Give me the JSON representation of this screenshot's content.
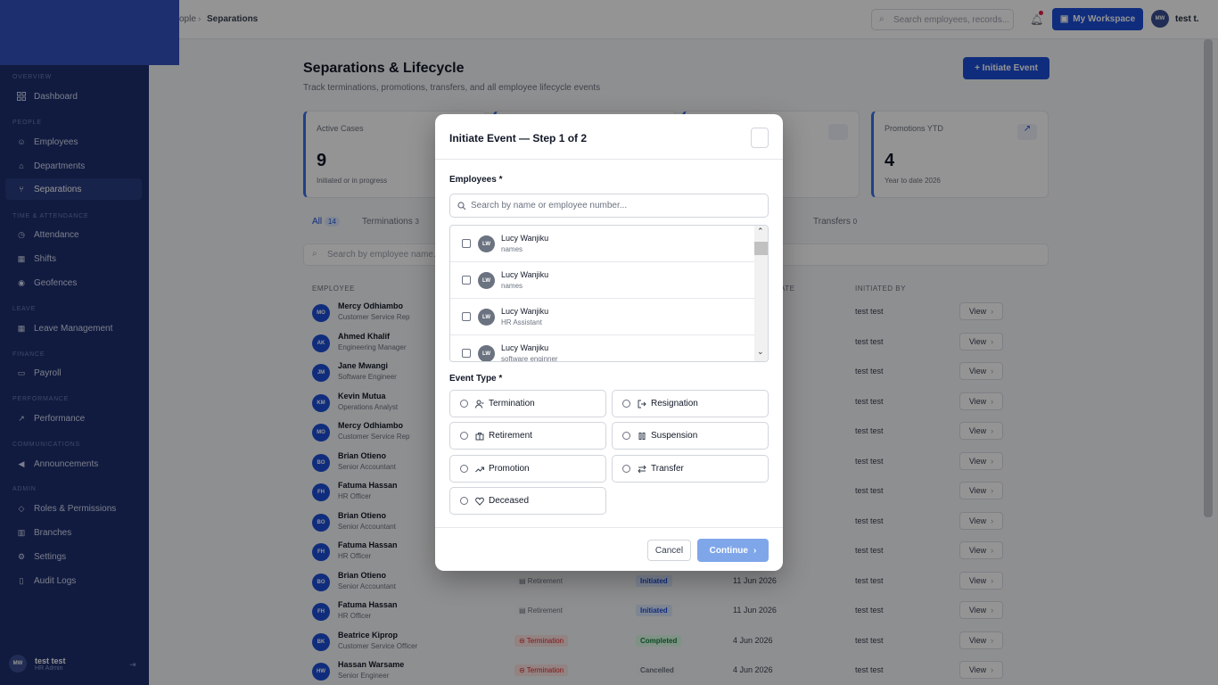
{
  "sidebar": {
    "sections": [
      {
        "label": "OVERVIEW",
        "items": [
          {
            "label": "Dashboard",
            "icon": "grid-icon"
          }
        ]
      },
      {
        "label": "PEOPLE",
        "items": [
          {
            "label": "Employees",
            "icon": "users-icon"
          },
          {
            "label": "Departments",
            "icon": "org-icon"
          },
          {
            "label": "Separations",
            "icon": "branch-icon"
          }
        ]
      },
      {
        "label": "TIME & ATTENDANCE",
        "items": [
          {
            "label": "Attendance",
            "icon": "clock-icon"
          },
          {
            "label": "Shifts",
            "icon": "calendar-icon"
          },
          {
            "label": "Geofences",
            "icon": "pin-icon"
          }
        ]
      },
      {
        "label": "LEAVE",
        "items": [
          {
            "label": "Leave Management",
            "icon": "calendar-icon"
          }
        ]
      },
      {
        "label": "FINANCE",
        "items": [
          {
            "label": "Payroll",
            "icon": "wallet-icon"
          }
        ]
      },
      {
        "label": "PERFORMANCE",
        "items": [
          {
            "label": "Performance",
            "icon": "trend-icon"
          }
        ]
      },
      {
        "label": "COMMUNICATIONS",
        "items": [
          {
            "label": "Announcements",
            "icon": "megaphone-icon"
          }
        ]
      },
      {
        "label": "ADMIN",
        "items": [
          {
            "label": "Roles & Permissions",
            "icon": "shield-icon"
          },
          {
            "label": "Branches",
            "icon": "building-icon"
          },
          {
            "label": "Settings",
            "icon": "gear-icon"
          },
          {
            "label": "Audit Logs",
            "icon": "file-icon"
          }
        ]
      }
    ],
    "user": {
      "initials": "MW",
      "name": "test test",
      "role": "HR Admin"
    }
  },
  "topbar": {
    "crumb_parent": "ople",
    "crumb_current": "Separations",
    "search_placeholder": "Search employees, records...",
    "workspace_label": "My Workspace",
    "user_initials": "MW",
    "user_name": "test t."
  },
  "page": {
    "title": "Separations & Lifecycle",
    "subtitle": "Track terminations, promotions, transfers, and all employee lifecycle events",
    "initiate_label": "+ Initiate Event",
    "cards": [
      {
        "label": "Active Cases",
        "value": "9",
        "sub": "Initiated or in progress"
      },
      {
        "label": "Promotions YTD",
        "value": "4",
        "sub": "Year to date 2026"
      }
    ],
    "tabs": [
      {
        "label": "All",
        "count": "14"
      },
      {
        "label": "Terminations",
        "count": "3"
      },
      {
        "label": "Transfers",
        "count": "0"
      }
    ],
    "table_search_placeholder": "Search by employee name...",
    "columns": {
      "employee": "EMPLOYEE",
      "date": "ATE",
      "initiated_by": "INITIATED BY"
    },
    "rows": [
      {
        "initials": "MO",
        "name": "Mercy Odhiambo",
        "role": "Customer Service Rep",
        "type": "",
        "status": "",
        "status_class": "",
        "date": "",
        "by": "test test",
        "view": "View"
      },
      {
        "initials": "AK",
        "name": "Ahmed Khalif",
        "role": "Engineering Manager",
        "type": "",
        "status": "",
        "status_class": "",
        "date": "",
        "by": "test test",
        "view": "View"
      },
      {
        "initials": "JM",
        "name": "Jane Mwangi",
        "role": "Software Engineer",
        "type": "",
        "status": "",
        "status_class": "",
        "date": "",
        "by": "test test",
        "view": "View"
      },
      {
        "initials": "KM",
        "name": "Kevin Mutua",
        "role": "Operations Analyst",
        "type": "",
        "status": "",
        "status_class": "",
        "date": "",
        "by": "test test",
        "view": "View"
      },
      {
        "initials": "MO",
        "name": "Mercy Odhiambo",
        "role": "Customer Service Rep",
        "type": "",
        "status": "",
        "status_class": "",
        "date": "",
        "by": "test test",
        "view": "View"
      },
      {
        "initials": "BO",
        "name": "Brian Otieno",
        "role": "Senior Accountant",
        "type": "",
        "status": "",
        "status_class": "",
        "date": "",
        "by": "test test",
        "view": "View"
      },
      {
        "initials": "FH",
        "name": "Fatuma Hassan",
        "role": "HR Officer",
        "type": "",
        "status": "",
        "status_class": "",
        "date": "",
        "by": "test test",
        "view": "View"
      },
      {
        "initials": "BO",
        "name": "Brian Otieno",
        "role": "Senior Accountant",
        "type": "",
        "status": "",
        "status_class": "",
        "date": "",
        "by": "test test",
        "view": "View"
      },
      {
        "initials": "FH",
        "name": "Fatuma Hassan",
        "role": "HR Officer",
        "type": "",
        "status": "",
        "status_class": "",
        "date": "",
        "by": "test test",
        "view": "View"
      },
      {
        "initials": "BO",
        "name": "Brian Otieno",
        "role": "Senior Accountant",
        "type": "Retirement",
        "status": "Initiated",
        "status_class": "initiated",
        "date": "11 Jun 2026",
        "by": "test test",
        "view": "View"
      },
      {
        "initials": "FH",
        "name": "Fatuma Hassan",
        "role": "HR Officer",
        "type": "Retirement",
        "status": "Initiated",
        "status_class": "initiated",
        "date": "11 Jun 2026",
        "by": "test test",
        "view": "View"
      },
      {
        "initials": "BK",
        "name": "Beatrice Kiprop",
        "role": "Customer Service Officer",
        "type": "Termination",
        "status": "Completed",
        "status_class": "completed",
        "date": "4 Jun 2026",
        "by": "test test",
        "view": "View"
      },
      {
        "initials": "HW",
        "name": "Hassan Warsame",
        "role": "Senior Engineer",
        "type": "Termination",
        "status": "Cancelled",
        "status_class": "cancelled",
        "date": "4 Jun 2026",
        "by": "test test",
        "view": "View"
      }
    ]
  },
  "modal": {
    "title": "Initiate Event — Step 1 of 2",
    "employees_label": "Employees *",
    "search_placeholder": "Search by name or employee number...",
    "employees": [
      {
        "initials": "LW",
        "name": "Lucy Wanjiku",
        "role": "names"
      },
      {
        "initials": "LW",
        "name": "Lucy Wanjiku",
        "role": "names"
      },
      {
        "initials": "LW",
        "name": "Lucy Wanjiku",
        "role": "HR Assistant"
      },
      {
        "initials": "LW",
        "name": "Lucy Wanjiku",
        "role": "software enginner"
      }
    ],
    "event_type_label": "Event Type *",
    "event_types": [
      {
        "label": "Termination",
        "icon": "user-minus-icon"
      },
      {
        "label": "Resignation",
        "icon": "log-out-icon"
      },
      {
        "label": "Retirement",
        "icon": "briefcase-icon"
      },
      {
        "label": "Suspension",
        "icon": "pause-icon"
      },
      {
        "label": "Promotion",
        "icon": "trend-up-icon"
      },
      {
        "label": "Transfer",
        "icon": "swap-icon"
      },
      {
        "label": "Deceased",
        "icon": "heart-icon"
      }
    ],
    "cancel_label": "Cancel",
    "continue_label": "Continue"
  },
  "colors": {
    "sidebar": "#1e2f6f",
    "primary": "#1d4ed8",
    "continue_disabled": "#7fa6e9",
    "termination": "#dc2626"
  }
}
